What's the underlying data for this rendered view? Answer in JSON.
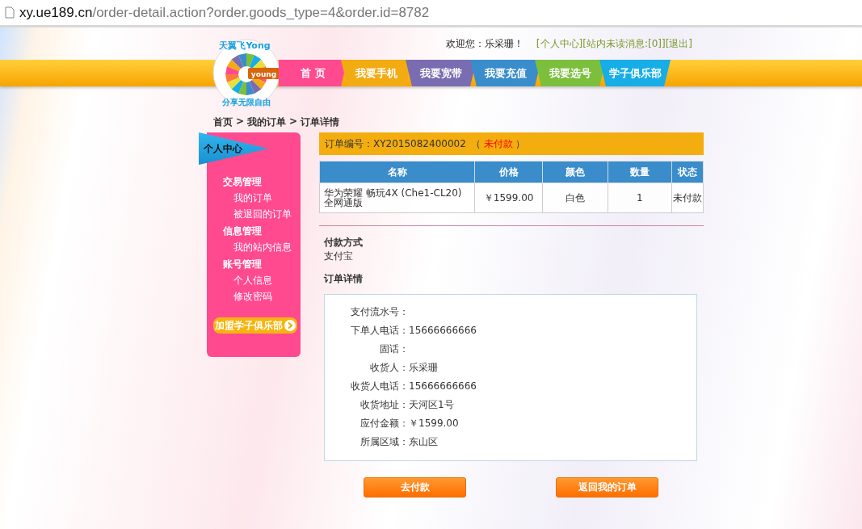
{
  "address_bar": {
    "host": "xy.ue189.cn",
    "path": "/order-detail.action?order.goods_type=4&order.id=8782"
  },
  "logo": {
    "title": "天翼飞Yong",
    "badge": "young",
    "tagline": "分享无限自由"
  },
  "header": {
    "welcome": "欢迎您：乐采珊！",
    "links": [
      {
        "label": "[个人中心]"
      },
      {
        "label": "[站内未读消息:[0]]"
      },
      {
        "label": "[退出]"
      }
    ]
  },
  "nav": [
    {
      "label": "首 页",
      "color": "#ff4a90"
    },
    {
      "label": "我要手机",
      "color": "#f3ab12"
    },
    {
      "label": "我要宽带",
      "color": "#7a6cb0"
    },
    {
      "label": "我要充值",
      "color": "#3a8dcb"
    },
    {
      "label": "我要选号",
      "color": "#7bbf3d"
    },
    {
      "label": "学子俱乐部",
      "color": "#17ade6"
    }
  ],
  "breadcrumb": {
    "separator": ">",
    "items": [
      {
        "label": "首页"
      },
      {
        "label": "我的订单"
      },
      {
        "label": "订单详情"
      }
    ]
  },
  "sidebar": {
    "title": "个人中心",
    "groups": [
      {
        "label": "交易管理",
        "items": [
          {
            "label": "我的订单"
          },
          {
            "label": "被退回的订单"
          }
        ]
      },
      {
        "label": "信息管理",
        "items": [
          {
            "label": "我的站内信息"
          }
        ]
      },
      {
        "label": "账号管理",
        "items": [
          {
            "label": "个人信息"
          },
          {
            "label": "修改密码"
          }
        ]
      }
    ],
    "join_button": "加盟学子俱乐部"
  },
  "order": {
    "label": "订单编号：XY2015082400002",
    "open_paren": "（",
    "status": "未付款",
    "close_paren": "）"
  },
  "table": {
    "columns": [
      "名称",
      "价格",
      "颜色",
      "数量",
      "状态"
    ],
    "rows": [
      [
        "华为荣耀 畅玩4X (Che1-CL20) 全网通版",
        "￥1599.00",
        "白色",
        "1",
        "未付款"
      ]
    ]
  },
  "payment": {
    "title": "付款方式",
    "value": "支付宝"
  },
  "details": {
    "title": "订单详情",
    "fields": [
      {
        "label": "支付流水号："
      },
      {
        "label": "下单人电话：",
        "value": "15666666666"
      },
      {
        "label": "固话："
      },
      {
        "label": "收货人：",
        "value": "乐采珊"
      },
      {
        "label": "收货人电话：",
        "value": "15666666666"
      },
      {
        "label": "收货地址：",
        "value": "天河区1号"
      },
      {
        "label": "应付金额：",
        "value": "￥1599.00"
      },
      {
        "label": "所属区域：",
        "value": "东山区"
      }
    ]
  },
  "buttons": [
    "去付款",
    "返回我的订单"
  ]
}
